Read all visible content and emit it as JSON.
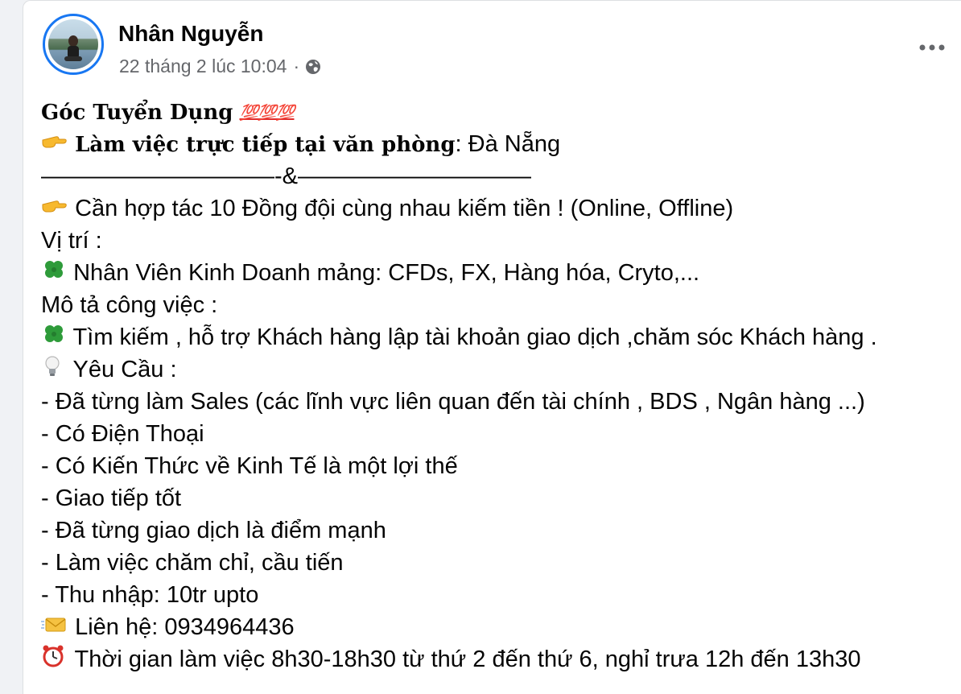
{
  "post": {
    "author": "Nhân Nguyễn",
    "timestamp": "22 tháng 2 lúc 10:04",
    "separator": "·",
    "audience_icon": "globe-icon",
    "more_icon": "more-options-icon",
    "accent_color": "#1877f2"
  },
  "content": {
    "title": "Góc Tuyển Dụng",
    "title_emoji": "💯💯💯",
    "location_label": "Làm việc trực tiếp tại văn phòng",
    "location_value": ": Đà Nẵng",
    "divider": "——————————-&——————————",
    "intro": "Cần hợp tác 10 Đồng đội cùng nhau kiếm tiền ! (Online, Offline)",
    "position_label": "Vị trí :",
    "position": "Nhân Viên Kinh Doanh mảng: CFDs, FX, Hàng hóa, Cryto,...",
    "description_label": "Mô tả công việc :",
    "description": "Tìm kiếm , hỗ trợ Khách hàng lập tài khoản giao dịch ,chăm sóc Khách hàng .",
    "requirements_label": "Yêu Cầu :",
    "requirements": [
      "- Đã từng làm Sales (các lĩnh vực liên quan đến tài chính , BDS , Ngân hàng ...)",
      "- Có Điện Thoại",
      "- Có Kiến Thức về Kinh Tế là một lợi thế",
      "- Giao tiếp tốt",
      "- Đã từng giao dịch là điểm mạnh",
      "- Làm việc chăm chỉ, cầu tiến",
      "- Thu nhập: 10tr upto"
    ],
    "contact": "Liên hệ: 0934964436",
    "working_hours": "Thời gian làm việc 8h30-18h30 từ thứ 2 đến thứ 6, nghỉ trưa 12h đến 13h30"
  }
}
